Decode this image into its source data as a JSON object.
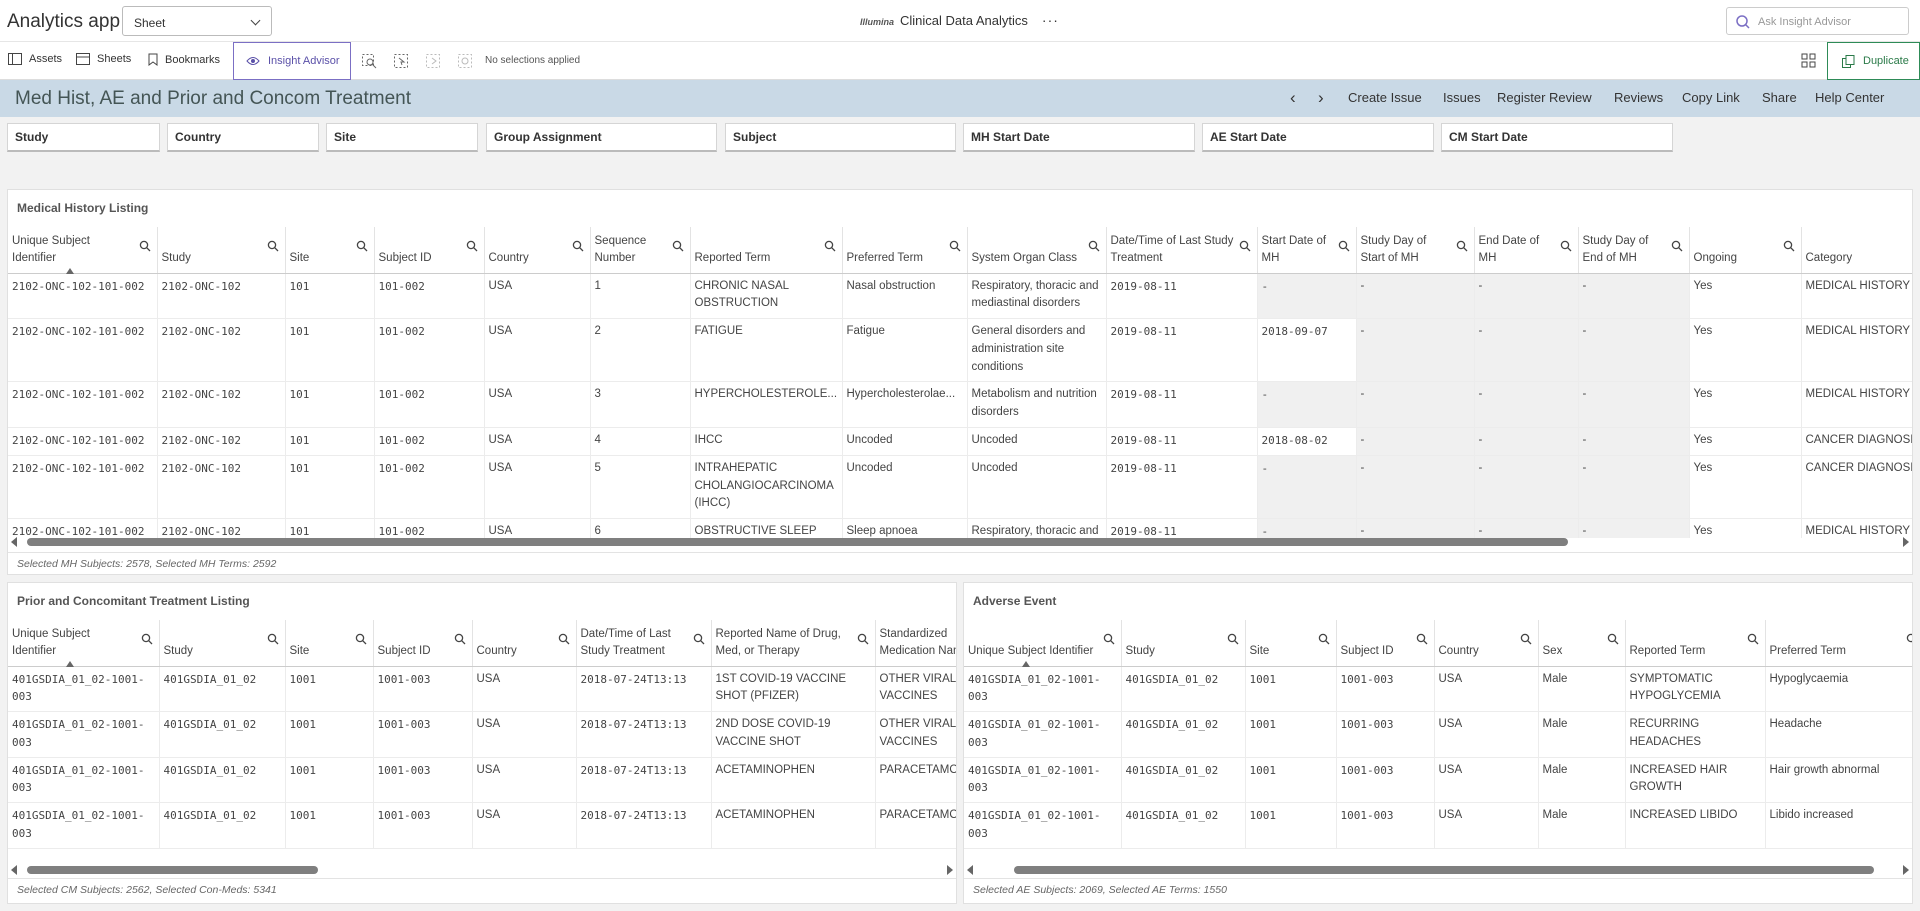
{
  "topbar": {
    "app_title": "Analytics app",
    "sheet_select": "Sheet",
    "brand": "Illumina",
    "center_title": "Clinical Data Analytics",
    "more": "···",
    "ask_placeholder": "Ask Insight Advisor"
  },
  "toolbar": {
    "assets": "Assets",
    "sheets": "Sheets",
    "bookmarks": "Bookmarks",
    "insight_advisor": "Insight Advisor",
    "no_selections": "No selections applied",
    "duplicate": "Duplicate"
  },
  "header": {
    "title": "Med Hist, AE and Prior and Concom Treatment",
    "prev": "‹",
    "next": "›",
    "links": [
      "Create Issue",
      "Issues",
      "Register Review",
      "Reviews",
      "Copy Link",
      "Share",
      "Help Center"
    ]
  },
  "filters": [
    "Study",
    "Country",
    "Site",
    "Group Assignment",
    "Subject",
    "MH Start Date",
    "AE Start Date",
    "CM Start Date"
  ],
  "medical_history": {
    "title": "Medical History Listing",
    "columns": [
      "Unique Subject Identifier",
      "Study",
      "Site",
      "Subject ID",
      "Country",
      "Sequence Number",
      "Reported Term",
      "Preferred Term",
      "System Organ Class",
      "Date/Time of Last Study Treatment",
      "Start Date of MH",
      "Study Day of Start of MH",
      "End Date of MH",
      "Study Day of End of MH",
      "Ongoing",
      "Category"
    ],
    "rows": [
      [
        "2102-ONC-102-101-002",
        "2102-ONC-102",
        "101",
        "101-002",
        "USA",
        "1",
        "CHRONIC NASAL OBSTRUCTION",
        "Nasal obstruction",
        "Respiratory, thoracic and mediastinal disorders",
        "2019-08-11",
        "-",
        "-",
        "-",
        "-",
        "Yes",
        "MEDICAL HISTORY"
      ],
      [
        "2102-ONC-102-101-002",
        "2102-ONC-102",
        "101",
        "101-002",
        "USA",
        "2",
        "FATIGUE",
        "Fatigue",
        "General disorders and administration site conditions",
        "2019-08-11",
        "2018-09-07",
        "-",
        "-",
        "-",
        "Yes",
        "MEDICAL HISTORY"
      ],
      [
        "2102-ONC-102-101-002",
        "2102-ONC-102",
        "101",
        "101-002",
        "USA",
        "3",
        "HYPERCHOLESTEROLE...",
        "Hypercholesterolae...",
        "Metabolism and nutrition disorders",
        "2019-08-11",
        "-",
        "-",
        "-",
        "-",
        "Yes",
        "MEDICAL HISTORY"
      ],
      [
        "2102-ONC-102-101-002",
        "2102-ONC-102",
        "101",
        "101-002",
        "USA",
        "4",
        "IHCC",
        "Uncoded",
        "Uncoded",
        "2019-08-11",
        "2018-08-02",
        "-",
        "-",
        "-",
        "Yes",
        "CANCER DIAGNOSIS -"
      ],
      [
        "2102-ONC-102-101-002",
        "2102-ONC-102",
        "101",
        "101-002",
        "USA",
        "5",
        "INTRAHEPATIC CHOLANGIOCARCINOMA (IHCC)",
        "Uncoded",
        "Uncoded",
        "2019-08-11",
        "-",
        "-",
        "-",
        "-",
        "Yes",
        "CANCER DIAGNOSIS"
      ],
      [
        "2102-ONC-102-101-002",
        "2102-ONC-102",
        "101",
        "101-002",
        "USA",
        "6",
        "OBSTRUCTIVE SLEEP APNEA",
        "Sleep apnoea syndrome",
        "Respiratory, thoracic and mediastinal disorders",
        "2019-08-11",
        "-",
        "-",
        "-",
        "-",
        "Yes",
        "MEDICAL HISTORY"
      ]
    ],
    "footnote": "Selected MH Subjects: 2578, Selected MH Terms: 2592"
  },
  "concomitant": {
    "title": "Prior and Concomitant Treatment Listing",
    "columns": [
      "Unique Subject Identifier",
      "Study",
      "Site",
      "Subject ID",
      "Country",
      "Date/Time of Last Study Treatment",
      "Reported Name of Drug, Med, or Therapy",
      "Standardized Medication Name"
    ],
    "rows": [
      [
        "401GSDIA_01_02-1001-003",
        "401GSDIA_01_02",
        "1001",
        "1001-003",
        "USA",
        "2018-07-24T13:13",
        "1ST COVID-19 VACCINE SHOT (PFIZER)",
        "OTHER VIRAL VACCINES"
      ],
      [
        "401GSDIA_01_02-1001-003",
        "401GSDIA_01_02",
        "1001",
        "1001-003",
        "USA",
        "2018-07-24T13:13",
        "2ND DOSE COVID-19 VACCINE SHOT",
        "OTHER VIRAL VACCINES"
      ],
      [
        "401GSDIA_01_02-1001-003",
        "401GSDIA_01_02",
        "1001",
        "1001-003",
        "USA",
        "2018-07-24T13:13",
        "ACETAMINOPHEN",
        "PARACETAMOL"
      ],
      [
        "401GSDIA_01_02-1001-003",
        "401GSDIA_01_02",
        "1001",
        "1001-003",
        "USA",
        "2018-07-24T13:13",
        "ACETAMINOPHEN",
        "PARACETAMOL"
      ]
    ],
    "footnote": "Selected CM Subjects: 2562, Selected Con-Meds: 5341"
  },
  "adverse_event": {
    "title": "Adverse Event",
    "columns": [
      "Unique Subject Identifier",
      "Study",
      "Site",
      "Subject ID",
      "Country",
      "Sex",
      "Reported Term",
      "Preferred Term"
    ],
    "rows": [
      [
        "401GSDIA_01_02-1001-003",
        "401GSDIA_01_02",
        "1001",
        "1001-003",
        "USA",
        "Male",
        "SYMPTOMATIC HYPOGLYCEMIA",
        "Hypoglycaemia"
      ],
      [
        "401GSDIA_01_02-1001-003",
        "401GSDIA_01_02",
        "1001",
        "1001-003",
        "USA",
        "Male",
        "RECURRING HEADACHES",
        "Headache"
      ],
      [
        "401GSDIA_01_02-1001-003",
        "401GSDIA_01_02",
        "1001",
        "1001-003",
        "USA",
        "Male",
        "INCREASED HAIR GROWTH",
        "Hair growth abnormal"
      ],
      [
        "401GSDIA_01_02-1001-003",
        "401GSDIA_01_02",
        "1001",
        "1001-003",
        "USA",
        "Male",
        "INCREASED LIBIDO",
        "Libido increased"
      ]
    ],
    "footnote": "Selected AE Subjects: 2069, Selected AE Terms: 1550"
  }
}
